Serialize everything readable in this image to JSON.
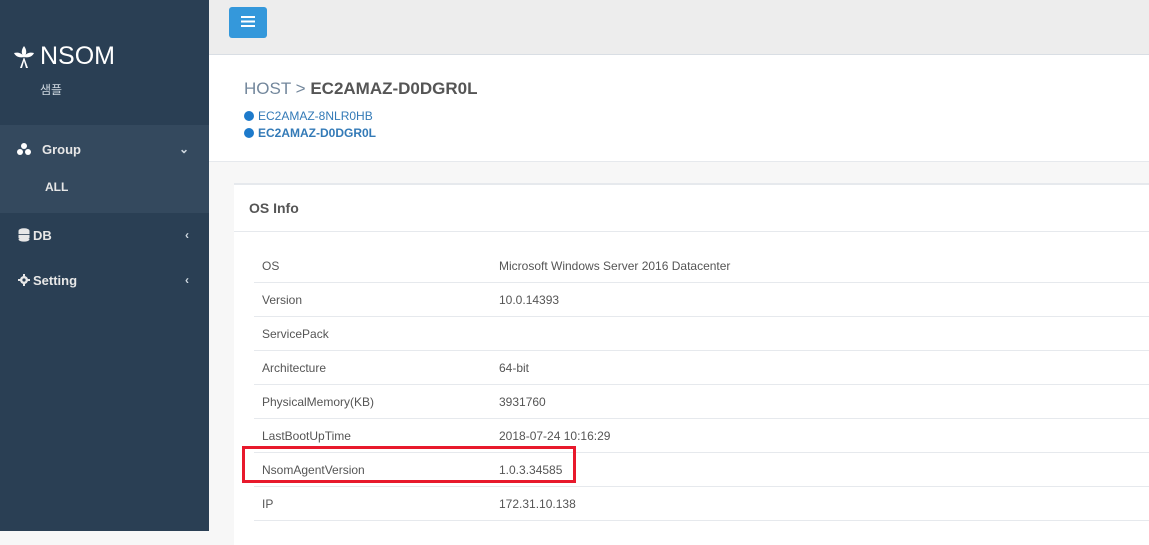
{
  "brand": {
    "name": "NSOM",
    "subtitle": "샘플"
  },
  "sidebar": {
    "items": [
      {
        "label": "Group",
        "icon": "sitemap-icon",
        "chevron": "⌄"
      },
      {
        "label": "DB",
        "icon": "database-icon",
        "chevron": "‹"
      },
      {
        "label": "Setting",
        "icon": "gear-icon",
        "chevron": "‹"
      }
    ],
    "group_sub": "ALL"
  },
  "breadcrumb": {
    "root": "HOST",
    "separator": ">",
    "current": "EC2AMAZ-D0DGR0L"
  },
  "hosts": [
    {
      "label": "EC2AMAZ-8NLR0HB"
    },
    {
      "label": "EC2AMAZ-D0DGR0L"
    }
  ],
  "os_panel": {
    "title": "OS Info",
    "rows": [
      {
        "key": "OS",
        "value": "Microsoft Windows Server 2016 Datacenter"
      },
      {
        "key": "Version",
        "value": "10.0.14393"
      },
      {
        "key": "ServicePack",
        "value": ""
      },
      {
        "key": "Architecture",
        "value": "64-bit"
      },
      {
        "key": "PhysicalMemory(KB)",
        "value": "3931760"
      },
      {
        "key": "LastBootUpTime",
        "value": "2018-07-24 10:16:29"
      },
      {
        "key": "NsomAgentVersion",
        "value": "1.0.3.34585"
      },
      {
        "key": "IP",
        "value": "172.31.10.138"
      }
    ]
  },
  "colors": {
    "sidebar": "#2a3f54",
    "accent": "#3498db",
    "link": "#337ab7",
    "highlight": "#e8192c"
  }
}
